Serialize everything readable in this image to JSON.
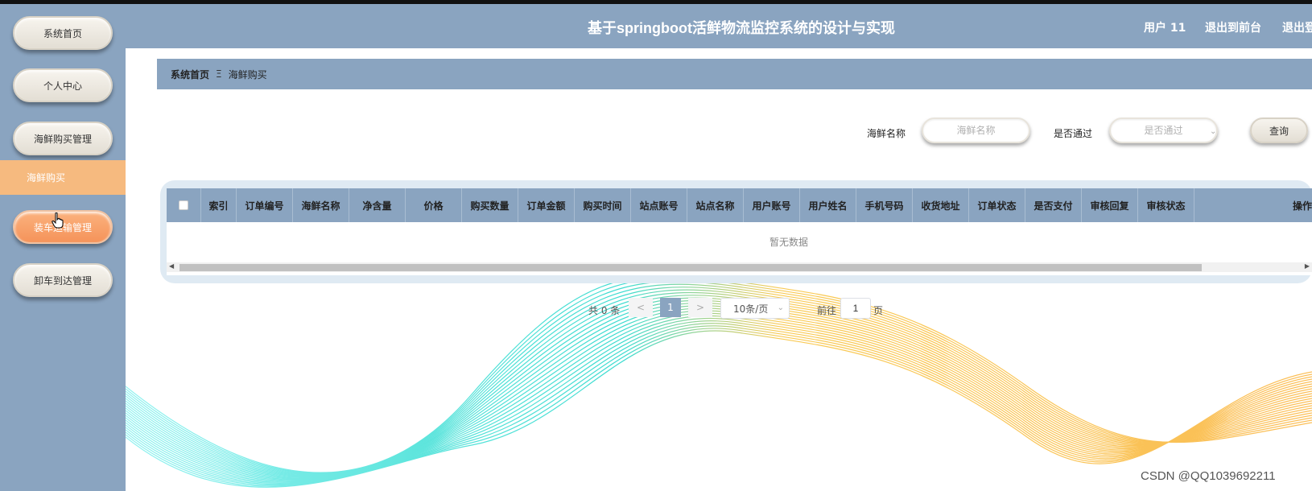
{
  "app": {
    "title": "基于springboot活鲜物流监控系统的设计与实现"
  },
  "header": {
    "user": "用户 11",
    "links": [
      "退出到前台",
      "退出登录"
    ]
  },
  "sidebar": {
    "items": [
      {
        "label": "系统首页"
      },
      {
        "label": "个人中心"
      },
      {
        "label": "海鲜购买管理"
      },
      {
        "label": "装车运输管理"
      },
      {
        "label": "卸车到达管理"
      }
    ],
    "sub_item": "海鲜购买"
  },
  "breadcrumb": {
    "home": "系统首页",
    "separator": "Ξ",
    "current": "海鲜购买"
  },
  "search": {
    "name_label": "海鲜名称",
    "name_placeholder": "海鲜名称",
    "pass_label": "是否通过",
    "pass_placeholder": "是否通过",
    "query_button": "查询"
  },
  "table": {
    "index_header": "索引",
    "columns": [
      "订单编号",
      "海鲜名称",
      "净含量",
      "价格",
      "购买数量",
      "订单金额",
      "购买时间",
      "站点账号",
      "站点名称",
      "用户账号",
      "用户姓名",
      "手机号码",
      "收货地址",
      "订单状态",
      "是否支付",
      "审核回复",
      "审核状态"
    ],
    "op_header": "操作",
    "empty_text": "暂无数据"
  },
  "pagination": {
    "total": "共 0 条",
    "prev": "<",
    "current_page": "1",
    "next": ">",
    "page_size": "10条/页",
    "goto_label": "前往",
    "goto_value": "1",
    "page_suffix": "页"
  },
  "watermark": "CSDN @QQ1039692211",
  "colors": {
    "theme": "#8aa4c0",
    "active": "#f5935a",
    "sub_active": "#f6ba7f"
  }
}
